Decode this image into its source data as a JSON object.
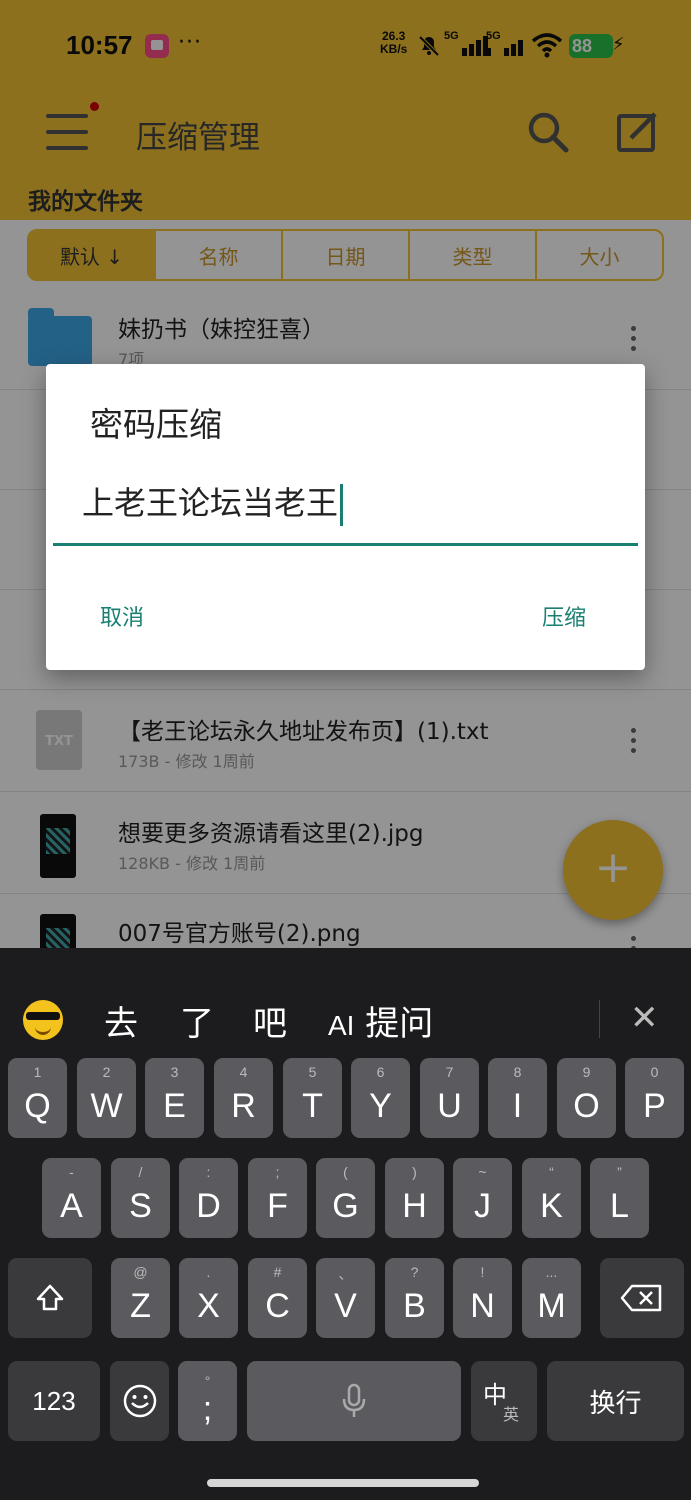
{
  "status_bar": {
    "time": "10:57",
    "more": "···",
    "net_speed_value": "26.3",
    "net_speed_unit": "KB/s",
    "sim1_label": "5G",
    "sim2_label": "5G",
    "battery": "88",
    "battery_color": "#2bc24a"
  },
  "app_bar": {
    "title": "压缩管理",
    "folder_label": "我的文件夹",
    "accent_color": "#f1c232"
  },
  "sort_tabs": [
    {
      "label": "默认 ↓",
      "active": true
    },
    {
      "label": "名称"
    },
    {
      "label": "日期"
    },
    {
      "label": "类型"
    },
    {
      "label": "大小"
    }
  ],
  "files": [
    {
      "name": "妹扔书（妹控狂喜）",
      "meta": "7项",
      "icon": "folder-icon"
    },
    {
      "name": "【老王论坛永久地址发布页】(1).txt",
      "meta": "173B - 修改 1周前",
      "icon": "txt-file-icon",
      "icon_text": "TXT"
    },
    {
      "name": "想要更多资源请看这里(2).jpg",
      "meta": "128KB - 修改 1周前",
      "icon": "image-thumbnail-icon"
    },
    {
      "name": "007号官方账号(2).png",
      "meta": "",
      "icon": "image-thumbnail-icon"
    }
  ],
  "fab": {
    "label": "+"
  },
  "dialog": {
    "title": "密码压缩",
    "password_value": "上老王论坛当老王",
    "cancel_label": "取消",
    "confirm_label": "压缩",
    "accent_color": "#1a7f72"
  },
  "keyboard": {
    "candidates": [
      "去",
      "了",
      "吧"
    ],
    "ai_label": "提问",
    "ai_icon_text": "AI",
    "row1": [
      {
        "k": "Q",
        "s": "1"
      },
      {
        "k": "W",
        "s": "2"
      },
      {
        "k": "E",
        "s": "3"
      },
      {
        "k": "R",
        "s": "4"
      },
      {
        "k": "T",
        "s": "5"
      },
      {
        "k": "Y",
        "s": "6"
      },
      {
        "k": "U",
        "s": "7"
      },
      {
        "k": "I",
        "s": "8"
      },
      {
        "k": "O",
        "s": "9"
      },
      {
        "k": "P",
        "s": "0"
      }
    ],
    "row2": [
      {
        "k": "A",
        "s": "-"
      },
      {
        "k": "S",
        "s": "/"
      },
      {
        "k": "D",
        "s": ":"
      },
      {
        "k": "F",
        "s": ";"
      },
      {
        "k": "G",
        "s": "("
      },
      {
        "k": "H",
        "s": ")"
      },
      {
        "k": "J",
        "s": "~"
      },
      {
        "k": "K",
        "s": "“"
      },
      {
        "k": "L",
        "s": "”"
      }
    ],
    "row3": [
      {
        "k": "Z",
        "s": "@"
      },
      {
        "k": "X",
        "s": "."
      },
      {
        "k": "C",
        "s": "#"
      },
      {
        "k": "V",
        "s": "、"
      },
      {
        "k": "B",
        "s": "?"
      },
      {
        "k": "N",
        "s": "!"
      },
      {
        "k": "M",
        "s": "..."
      }
    ],
    "numbers_label": "123",
    "punct_main": ";",
    "punct_sub": "°",
    "lang_main": "中",
    "lang_sub": "英",
    "enter_label": "换行"
  }
}
